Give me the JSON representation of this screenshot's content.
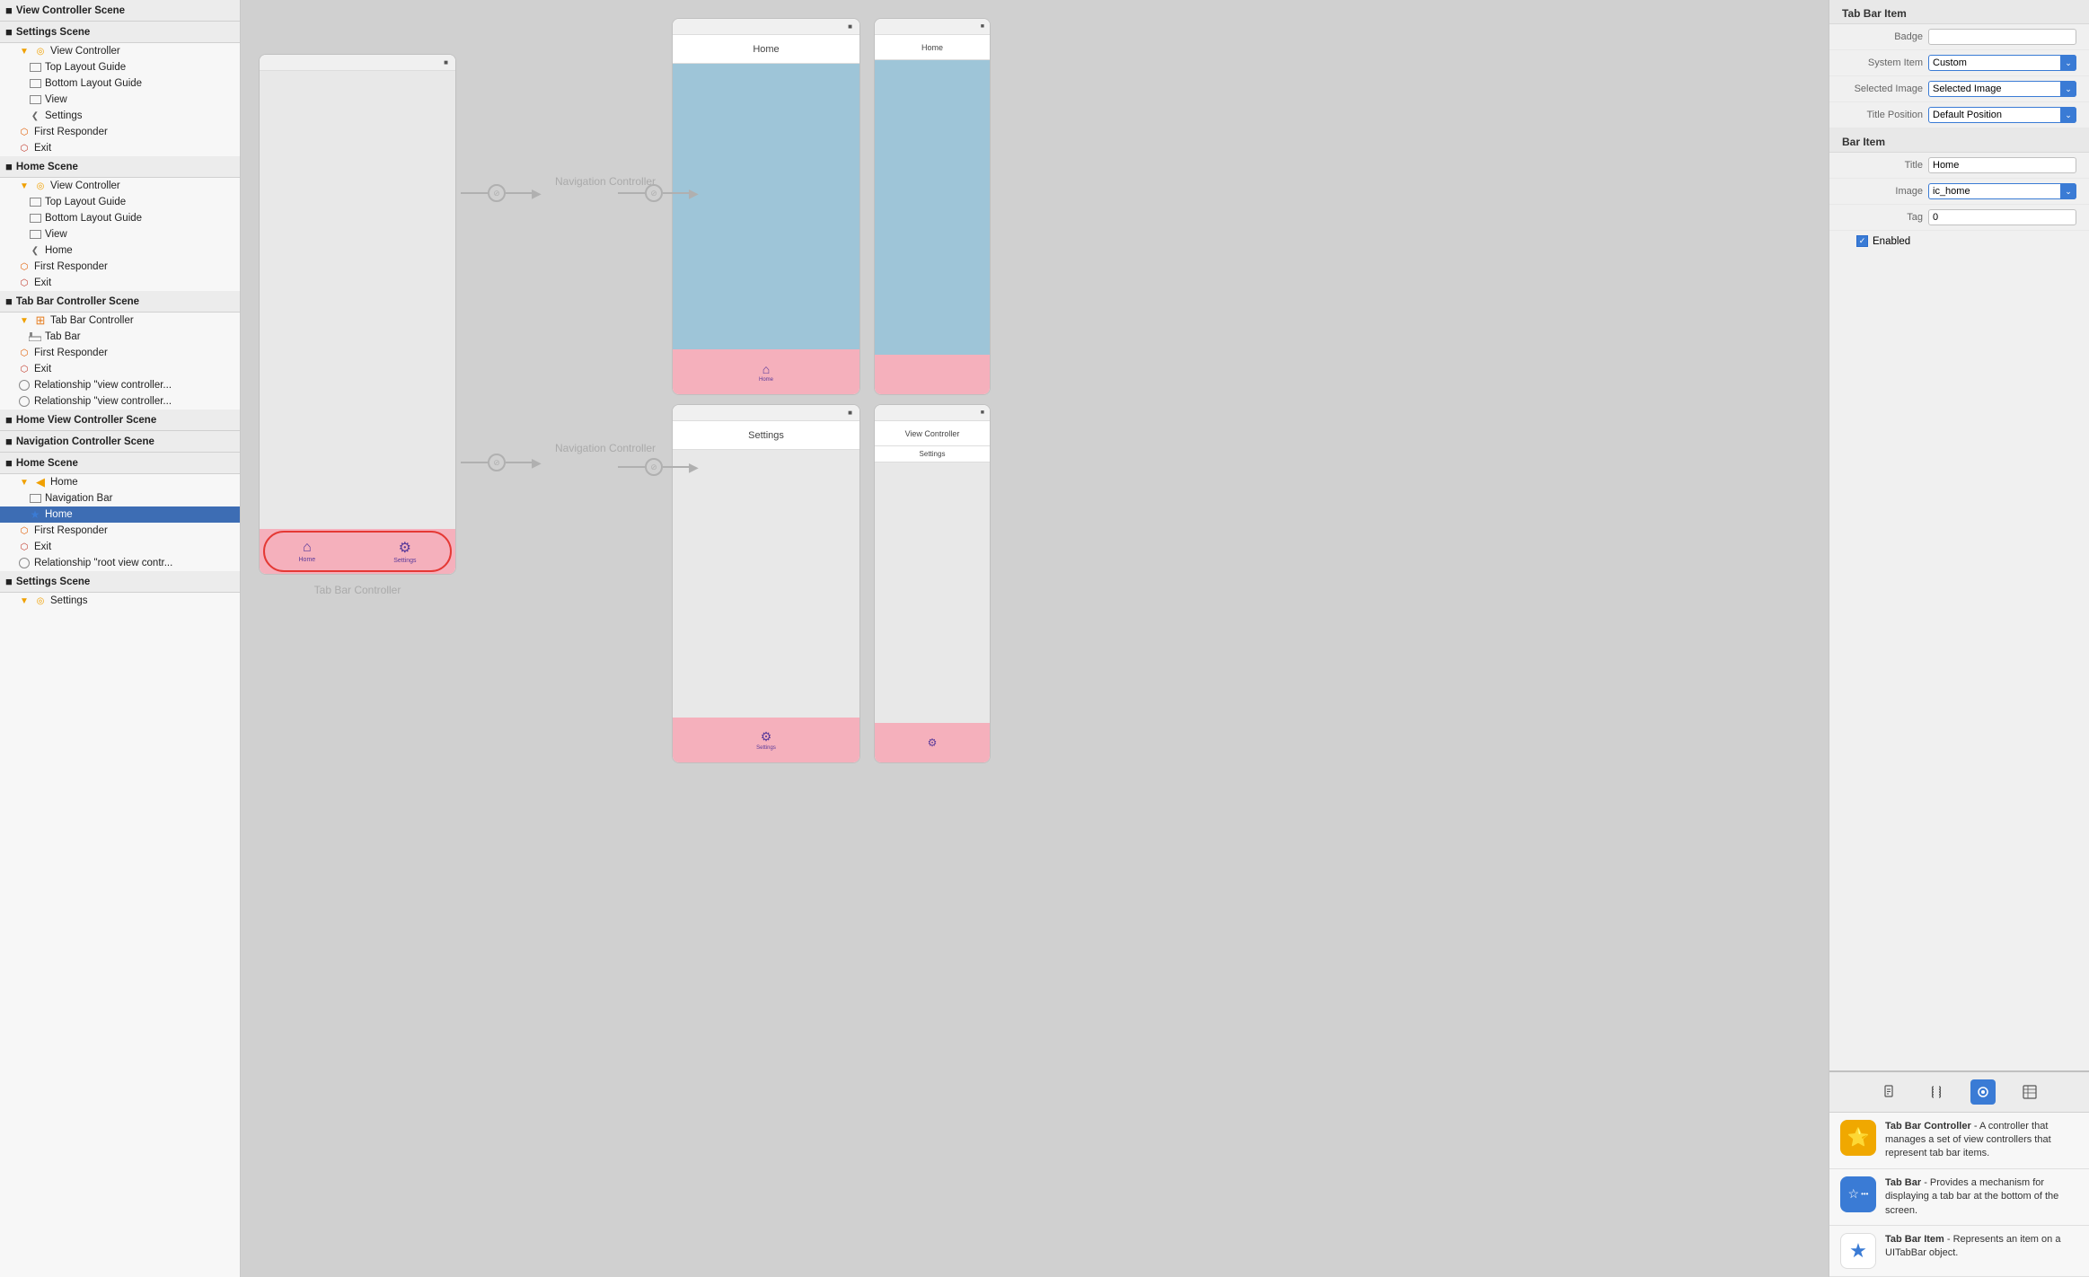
{
  "leftPanel": {
    "scenes": [
      {
        "title": "View Controller Scene",
        "icon": "■",
        "items": []
      },
      {
        "title": "Settings Scene",
        "icon": "■",
        "items": [
          {
            "indent": 1,
            "icon": "triangle-yellow",
            "label": "View Controller"
          },
          {
            "indent": 2,
            "icon": "rect",
            "label": "Top Layout Guide"
          },
          {
            "indent": 2,
            "icon": "rect",
            "label": "Bottom Layout Guide"
          },
          {
            "indent": 2,
            "icon": "rect",
            "label": "View"
          },
          {
            "indent": 2,
            "icon": "back",
            "label": "Settings"
          },
          {
            "indent": 1,
            "icon": "responder",
            "label": "First Responder"
          },
          {
            "indent": 1,
            "icon": "exit",
            "label": "Exit"
          }
        ]
      },
      {
        "title": "Home Scene",
        "icon": "■",
        "items": [
          {
            "indent": 1,
            "icon": "triangle-yellow",
            "label": "View Controller"
          },
          {
            "indent": 2,
            "icon": "rect",
            "label": "Top Layout Guide"
          },
          {
            "indent": 2,
            "icon": "rect",
            "label": "Bottom Layout Guide"
          },
          {
            "indent": 2,
            "icon": "rect",
            "label": "View"
          },
          {
            "indent": 2,
            "icon": "back",
            "label": "Home"
          },
          {
            "indent": 1,
            "icon": "responder",
            "label": "First Responder"
          },
          {
            "indent": 1,
            "icon": "exit",
            "label": "Exit"
          }
        ]
      },
      {
        "title": "Tab Bar Controller Scene",
        "icon": "■",
        "items": [
          {
            "indent": 1,
            "icon": "triangle-tbc",
            "label": "Tab Bar Controller"
          },
          {
            "indent": 2,
            "icon": "tabbar",
            "label": "Tab Bar"
          },
          {
            "indent": 1,
            "icon": "responder",
            "label": "First Responder"
          },
          {
            "indent": 1,
            "icon": "exit",
            "label": "Exit"
          },
          {
            "indent": 1,
            "icon": "circle",
            "label": "Relationship \"view controller..."
          },
          {
            "indent": 1,
            "icon": "circle",
            "label": "Relationship \"view controller..."
          }
        ]
      },
      {
        "title": "Home View Controller Scene",
        "icon": "■",
        "items": []
      },
      {
        "title": "Navigation Controller Scene",
        "icon": "■",
        "items": []
      },
      {
        "title": "Home Scene",
        "icon": "■",
        "items": [
          {
            "indent": 1,
            "icon": "triangle-nav",
            "label": "Home"
          },
          {
            "indent": 2,
            "icon": "rect",
            "label": "Navigation Bar"
          },
          {
            "indent": 2,
            "icon": "star",
            "label": "Home",
            "selected": true
          },
          {
            "indent": 1,
            "icon": "responder",
            "label": "First Responder"
          },
          {
            "indent": 1,
            "icon": "exit",
            "label": "Exit"
          },
          {
            "indent": 1,
            "icon": "circle",
            "label": "Relationship \"root view contr..."
          }
        ]
      },
      {
        "title": "Settings Scene",
        "icon": "■",
        "items": [
          {
            "indent": 1,
            "icon": "triangle-yellow",
            "label": "Settings"
          }
        ]
      }
    ]
  },
  "rightPanel": {
    "topTitle": "Tab Bar Item",
    "badgeLabel": "Badge",
    "systemItemLabel": "System Item",
    "systemItemValue": "Custom",
    "selectedImageLabel": "Selected Image",
    "selectedImageValue": "Selected Image",
    "titlePositionLabel": "Title Position",
    "titlePositionValue": "Default Position",
    "barItemTitle": "Bar Item",
    "titleLabel": "Title",
    "titleValue": "Home",
    "imageLabel": "Image",
    "imageValue": "ic_home",
    "tagLabel": "Tag",
    "tagValue": "0",
    "enabledLabel": "Enabled",
    "enabledChecked": true,
    "tabIconLabels": [
      "file",
      "curly",
      "circle-active",
      "table"
    ],
    "infoItems": [
      {
        "icon": "⭐",
        "iconBg": "yellow-bg",
        "title": "Tab Bar Controller",
        "desc": " - A controller that manages a set of view controllers that represent tab bar items."
      },
      {
        "icon": "☆",
        "iconBg": "blue-bg",
        "title": "Tab Bar",
        "desc": " - Provides a mechanism for displaying a tab bar at the bottom of the screen."
      },
      {
        "icon": "★",
        "iconBg": "white-bg",
        "title": "Tab Bar Item",
        "desc": " - Represents an item on a UITabBar object."
      }
    ]
  },
  "canvas": {
    "tabBarControllerLabel": "Tab Bar Controller",
    "navigationControllerLabel1": "Navigation Controller",
    "navigationControllerLabel2": "Navigation Controller",
    "homeLabel": "Home",
    "settingsLabel": "Settings",
    "viewControllerLabel": "View Controller",
    "tabBarControllerSceneLabel": "Tab Bar Controller",
    "phoneHomeNavTitle": "Home",
    "phoneSettingsNavTitle": "Settings",
    "phoneViewControllerTitle": "View Controller",
    "settingsTabLabel": "Settings",
    "homeTabLabel": "Home"
  }
}
